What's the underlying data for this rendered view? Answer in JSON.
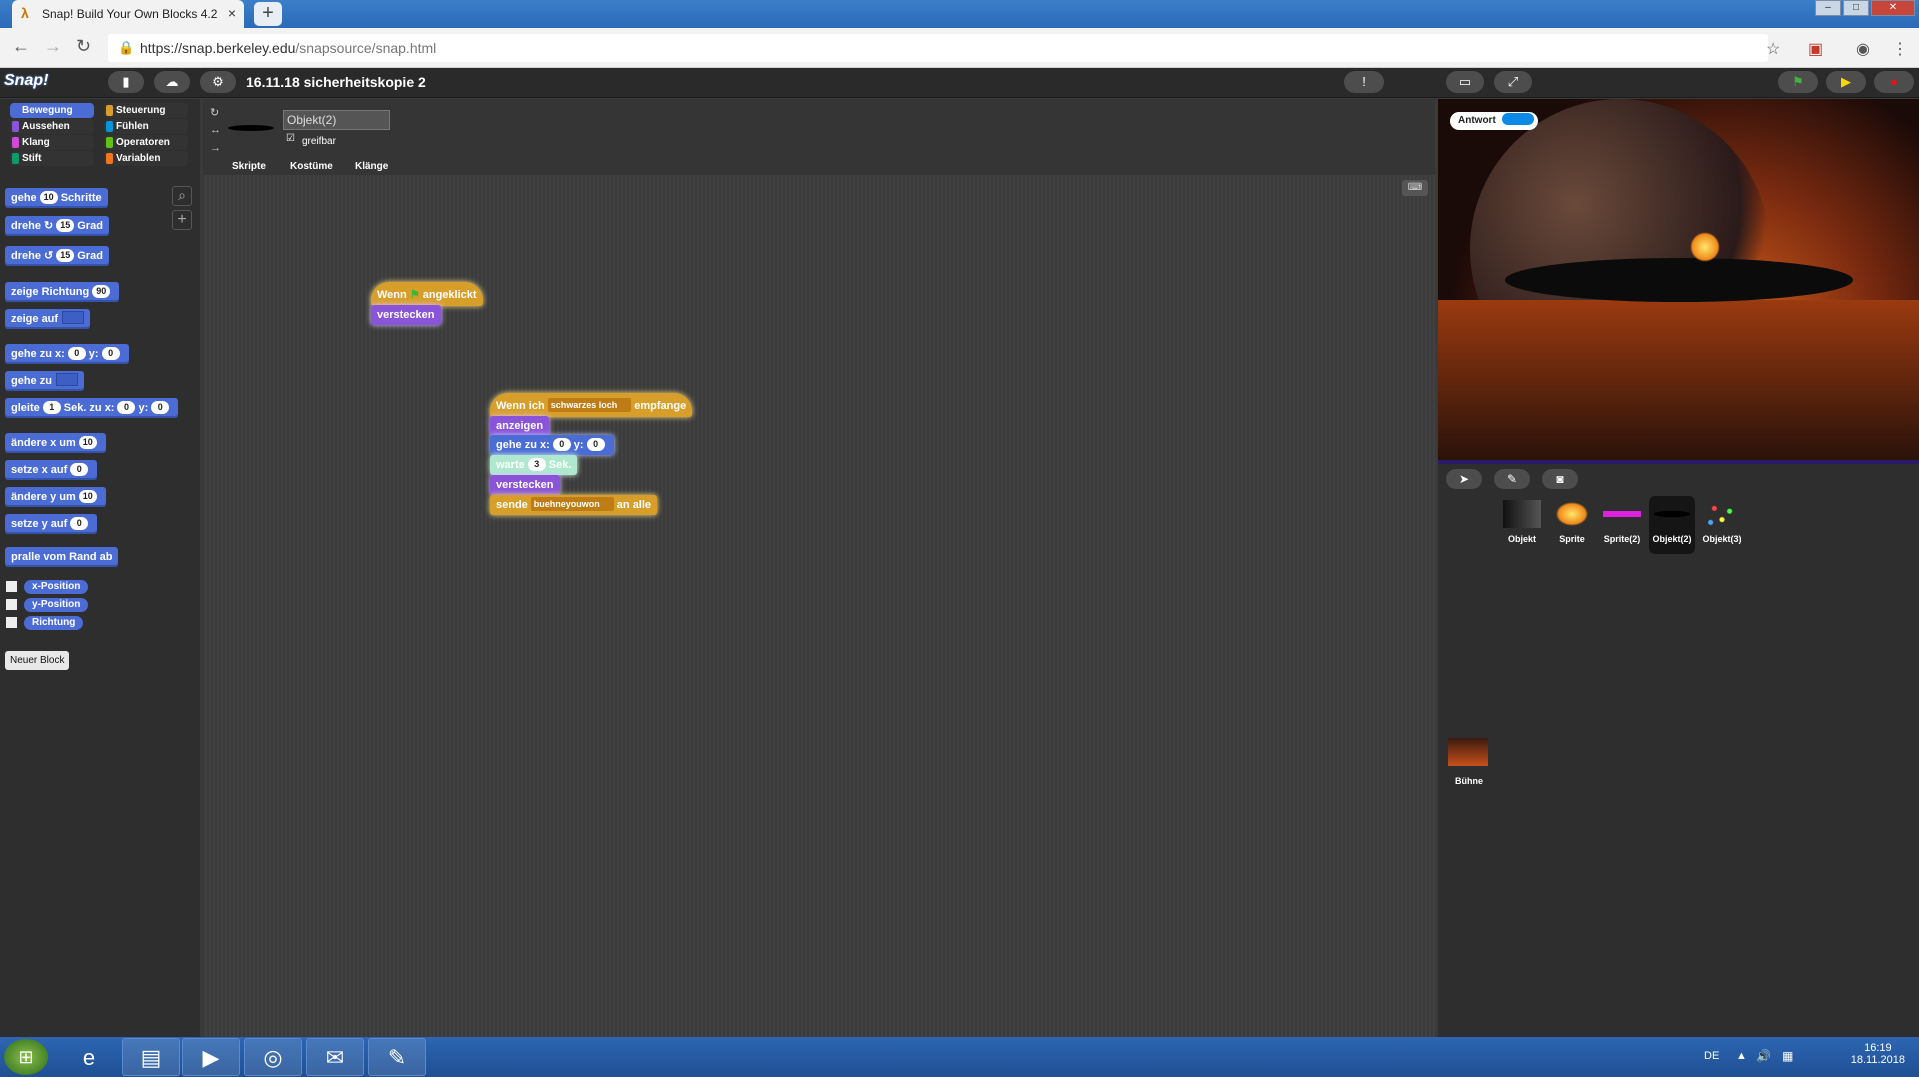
{
  "browser": {
    "tab_title": "Snap! Build Your Own Blocks 4.2",
    "url_host": "https://snap.berkeley.edu",
    "url_path": "/snapsource/snap.html",
    "accent": "#2a6ab8"
  },
  "snap": {
    "logo": "Snap!",
    "project_title": "16.11.18 sicherheitskopie 2",
    "categories": [
      "Bewegung",
      "Aussehen",
      "Klang",
      "Stift",
      "Steuerung",
      "Fühlen",
      "Operatoren",
      "Variablen"
    ],
    "selected_category": "Bewegung",
    "category_colors": {
      "Bewegung": "#4a6cd4",
      "Aussehen": "#8a54d8",
      "Klang": "#cf4ad9",
      "Stift": "#0e9a6c",
      "Steuerung": "#d89e2a",
      "Fühlen": "#0494dc",
      "Operatoren": "#62c213",
      "Variablen": "#f3761d"
    },
    "palette": {
      "b1": "gehe",
      "b1v": "10",
      "b1b": "Schritte",
      "b2": "drehe",
      "b2v": "15",
      "b2b": "Grad",
      "b3": "drehe",
      "b3v": "15",
      "b3b": "Grad",
      "b4": "zeige Richtung",
      "b4v": "90",
      "b5": "zeige auf",
      "b6": "gehe zu x:",
      "b6x": "0",
      "b6y": "y:",
      "b6yv": "0",
      "b7": "gehe zu",
      "b8": "gleite",
      "b8v": "1",
      "b8b": "Sek. zu x:",
      "b8x": "0",
      "b8y": "y:",
      "b8yv": "0",
      "b9": "ändere x um",
      "b9v": "10",
      "b10": "setze x auf",
      "b10v": "0",
      "b11": "ändere y um",
      "b11v": "10",
      "b12": "setze y auf",
      "b12v": "0",
      "b13": "pralle vom Rand ab",
      "r1": "x-Position",
      "r2": "y-Position",
      "r3": "Richtung",
      "new_block": "Neuer Block"
    },
    "sprite": {
      "name": "Objekt(2)",
      "draggable_label": "greifbar",
      "tabs": [
        "Skripte",
        "Kostüme",
        "Klänge"
      ]
    },
    "script1": {
      "hat_a": "Wenn",
      "hat_b": "angeklickt",
      "s1": "verstecken"
    },
    "script2": {
      "hat_a": "Wenn ich",
      "hat_msg": "schwarzes loch",
      "hat_b": "empfange",
      "s1": "anzeigen",
      "s2": "gehe zu x:",
      "s2x": "0",
      "s2y": "y:",
      "s2yv": "0",
      "s3": "warte",
      "s3v": "3",
      "s3b": "Sek.",
      "s4": "verstecken",
      "s5": "sende",
      "s5msg": "buehneyouwon",
      "s5b": "an alle"
    },
    "stage": {
      "answer_label": "Antwort"
    },
    "sprites": [
      "Objekt",
      "Sprite",
      "Sprite(2)",
      "Objekt(2)",
      "Objekt(3)"
    ],
    "selected_sprite": "Objekt(2)",
    "stage_label": "Bühne"
  },
  "taskbar": {
    "lang": "DE",
    "time": "16:19",
    "date": "18.11.2018"
  }
}
